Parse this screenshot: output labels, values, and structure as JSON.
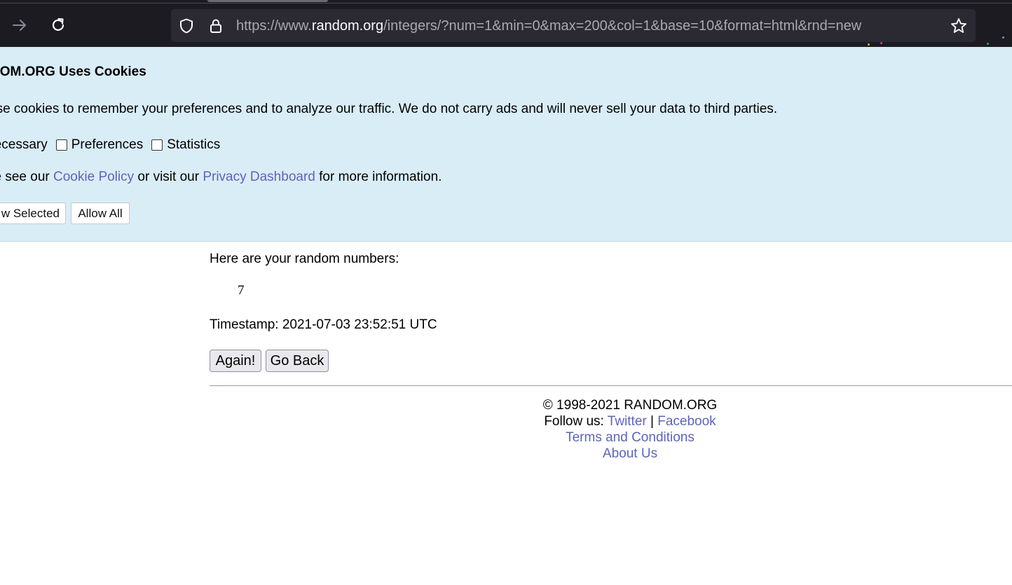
{
  "browser": {
    "url_scheme": "https://www.",
    "url_host": "random.org",
    "url_path": "/integers/?num=1&min=0&max=200&col=1&base=10&format=html&rnd=new"
  },
  "cookie_banner": {
    "title": "DOM.ORG Uses Cookies",
    "message": "use cookies to remember your preferences and to analyze our traffic. We do not carry ads and will never sell your data to third parties.",
    "options": {
      "necessary": "Necessary",
      "preferences": "Preferences",
      "statistics": "Statistics",
      "preferences_checked": false,
      "statistics_checked": false
    },
    "info_prefix": "se see our",
    "cookie_policy_link": "Cookie Policy",
    "info_middle": "or visit our",
    "privacy_dashboard_link": "Privacy Dashboard",
    "info_suffix": "for more information.",
    "allow_selected_button": "w Selected",
    "allow_all_button": "Allow All"
  },
  "result": {
    "intro": "Here are your random numbers:",
    "numbers": [
      "7"
    ],
    "timestamp": "Timestamp: 2021-07-03 23:52:51 UTC",
    "again_button": "Again!",
    "go_back_button": "Go Back"
  },
  "footer": {
    "copyright": "© 1998-2021 RANDOM.ORG",
    "follow_label": "Follow us:",
    "twitter_link": "Twitter",
    "separator": "|",
    "facebook_link": "Facebook",
    "terms_link": "Terms and Conditions",
    "about_link": "About Us"
  },
  "colors": {
    "banner_bg": "#d9edf7",
    "link": "#5e64b8",
    "chrome_bg": "#1c1b22",
    "urlbar_bg": "#2b2a33"
  }
}
